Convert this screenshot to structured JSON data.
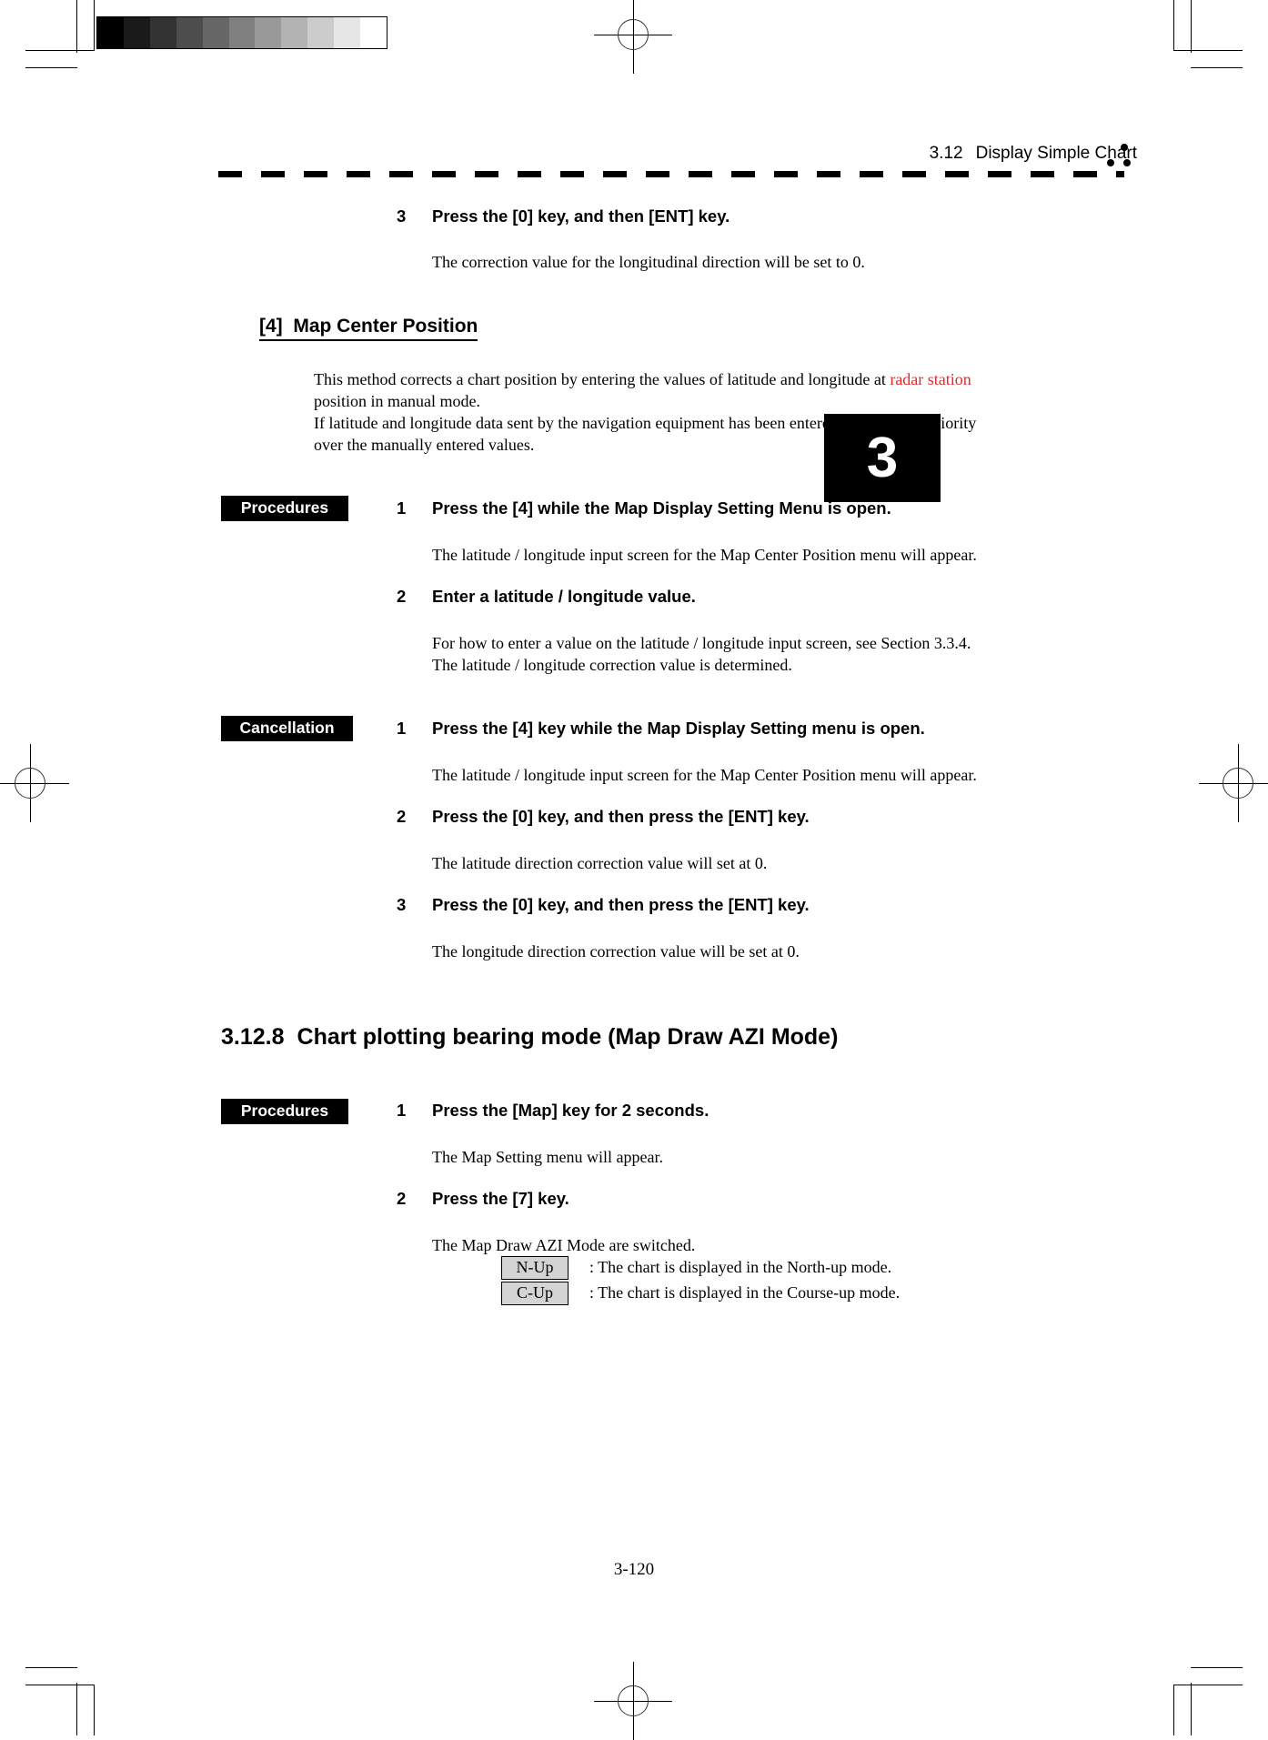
{
  "header": {
    "section_number": "3.12",
    "section_title": "Display Simple Chart",
    "dots_icon": "three-dots-icon"
  },
  "chapter_tab": {
    "number": "3"
  },
  "grayscale_strip": {
    "name": "grayscale-calibration-strip",
    "steps": [
      "#000000",
      "#1a1a1a",
      "#333333",
      "#4d4d4d",
      "#666666",
      "#808080",
      "#999999",
      "#b3b3b3",
      "#cccccc",
      "#e6e6e6",
      "#ffffff"
    ]
  },
  "top_step": {
    "number": "3",
    "title": "Press the [0] key, and then [ENT] key.",
    "body": "The correction value for the longitudinal direction will be set to 0."
  },
  "map_center": {
    "heading_tag": "[4]",
    "heading_text": "Map Center Position",
    "intro_line1_a": "This method corrects a chart position by entering the values of latitude and longitude at ",
    "intro_line1_red": "radar station",
    "intro_line2": "position in manual mode.",
    "intro_line3": "If latitude and longitude data sent by the navigation equipment has been entered, the data has priority",
    "intro_line4": "over the manually entered values."
  },
  "procedures_label": "Procedures",
  "cancellation_label": "Cancellation",
  "procedures_steps": [
    {
      "number": "1",
      "title": "Press the [4] while the Map Display Setting Menu is open.",
      "body": "The latitude / longitude input screen for the Map Center Position menu will appear."
    },
    {
      "number": "2",
      "title": "Enter a latitude / longitude value.",
      "body_line1": "For how to enter a value on the latitude / longitude input screen, see Section 3.3.4.",
      "body_line2": "The latitude / longitude correction value is determined."
    }
  ],
  "cancellation_steps": [
    {
      "number": "1",
      "title": "Press the [4] key while the Map Display Setting menu is open.",
      "body": "The latitude / longitude input screen for the Map Center Position menu will appear."
    },
    {
      "number": "2",
      "title": "Press the [0] key, and then press the [ENT] key.",
      "body": "The latitude direction correction value will set at 0."
    },
    {
      "number": "3",
      "title": "Press the [0] key, and then press the [ENT] key.",
      "body": "The longitude direction correction value will be set at 0."
    }
  ],
  "section_3128": {
    "number": "3.12.8",
    "title": "Chart plotting bearing mode (Map Draw AZI Mode)",
    "procedures_label": "Procedures",
    "steps": [
      {
        "number": "1",
        "title": "Press the [Map] key for 2 seconds.",
        "body": "The Map Setting menu will appear."
      },
      {
        "number": "2",
        "title": "Press the [7] key.",
        "body": "The Map Draw AZI Mode are switched."
      }
    ],
    "modes": [
      {
        "box": "N-Up",
        "description": ": The chart is displayed in the North-up mode."
      },
      {
        "box": "C-Up",
        "description": ": The chart is displayed in the Course-up mode."
      }
    ]
  },
  "page_number": "3-120"
}
